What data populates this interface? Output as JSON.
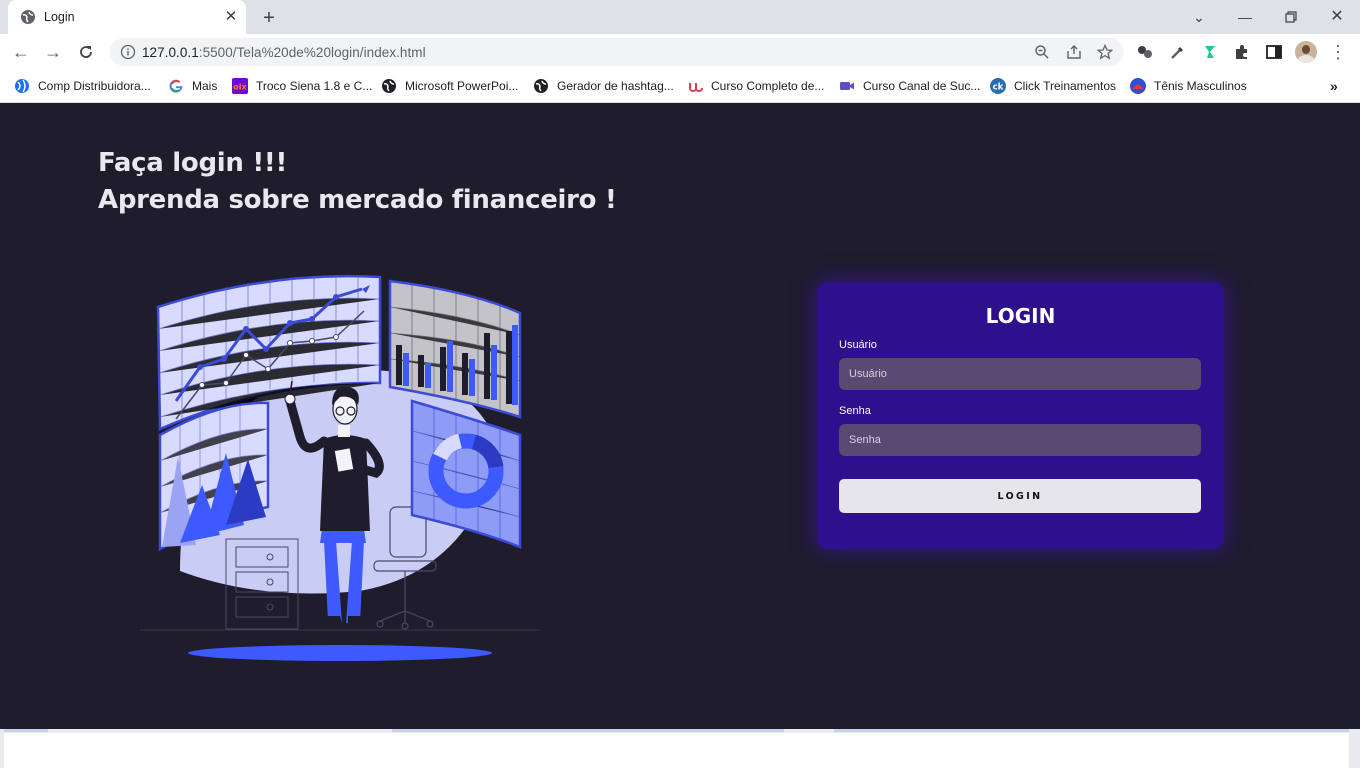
{
  "browser": {
    "tab_title": "Login",
    "url_host": "127.0.0.1",
    "url_rest": ":5500/Tela%20de%20login/index.html",
    "bookmarks": [
      {
        "label": "Comp Distribuidora...",
        "icon": "globe-blue-icon"
      },
      {
        "label": "Mais",
        "icon": "google-icon"
      },
      {
        "label": "Troco Siena 1.8 e C...",
        "icon": "olx-icon"
      },
      {
        "label": "Microsoft PowerPoi...",
        "icon": "globe-icon"
      },
      {
        "label": "Gerador de hashtag...",
        "icon": "globe-icon"
      },
      {
        "label": "Curso Completo de...",
        "icon": "udemy-icon"
      },
      {
        "label": "Curso Canal de Suc...",
        "icon": "video-icon"
      },
      {
        "label": "Click Treinamentos",
        "icon": "ck-icon"
      },
      {
        "label": "Tênis Masculinos",
        "icon": "shoe-store-icon"
      }
    ]
  },
  "page": {
    "heading_line1": "Faça login !!!",
    "heading_line2": "Aprenda sobre mercado financeiro !"
  },
  "login": {
    "title": "LOGIN",
    "user_label": "Usuário",
    "user_placeholder": "Usuário",
    "pass_label": "Senha",
    "pass_placeholder": "Senha",
    "button_label": "LOGIN"
  },
  "colors": {
    "page_bg": "#1f1c2c",
    "card_bg": "#2e0f8c",
    "input_bg": "#5a4a72",
    "accent_blue": "#3d5afe"
  }
}
